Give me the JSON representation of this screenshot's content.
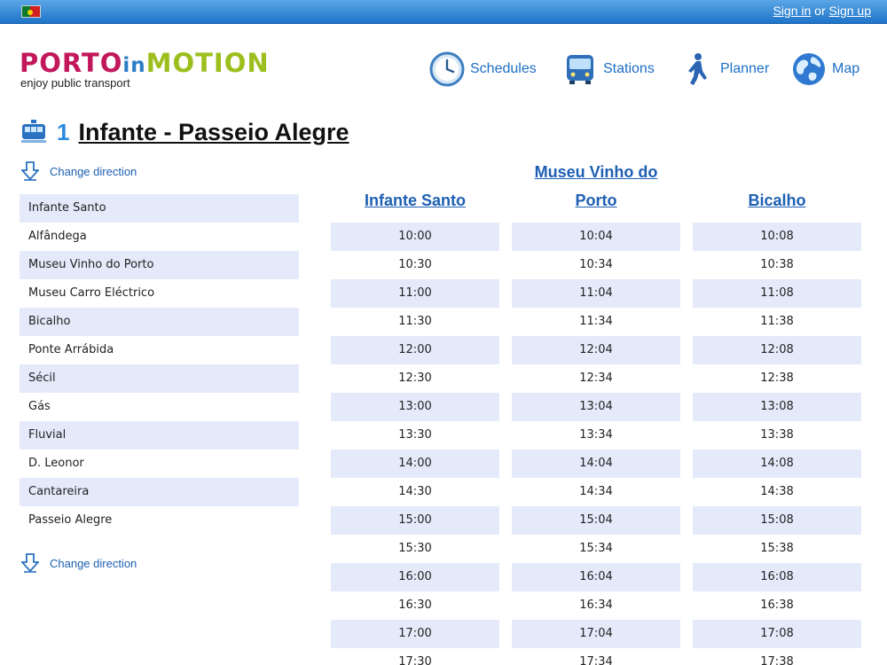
{
  "topbar": {
    "signin": "Sign in",
    "or": "or",
    "signup": "Sign up"
  },
  "logo": {
    "part1": "PORTO",
    "part2": "in",
    "part3": "MOTION",
    "tagline": "enjoy public transport"
  },
  "nav": [
    {
      "label": "Schedules",
      "icon": "clock-icon"
    },
    {
      "label": "Stations",
      "icon": "bus-icon"
    },
    {
      "label": "Planner",
      "icon": "walking-person-icon"
    },
    {
      "label": "Map",
      "icon": "globe-icon"
    }
  ],
  "route": {
    "number": "1",
    "name": "Infante - Passeio Alegre",
    "icon": "tram-icon"
  },
  "change_direction": "Change direction",
  "stops": [
    "Infante Santo",
    "Alfândega",
    "Museu Vinho do Porto",
    "Museu Carro Eléctrico",
    "Bicalho",
    "Ponte Arrábida",
    "Sécil",
    "Gás",
    "Fluvial",
    "D. Leonor",
    "Cantareira",
    "Passeio Alegre"
  ],
  "timetable": {
    "columns": [
      {
        "header_line1": "",
        "header_line2": "Infante Santo",
        "times": [
          "10:00",
          "10:30",
          "11:00",
          "11:30",
          "12:00",
          "12:30",
          "13:00",
          "13:30",
          "14:00",
          "14:30",
          "15:00",
          "15:30",
          "16:00",
          "16:30",
          "17:00",
          "17:30"
        ]
      },
      {
        "header_line1": "Museu Vinho do",
        "header_line2": "Porto",
        "times": [
          "10:04",
          "10:34",
          "11:04",
          "11:34",
          "12:04",
          "12:34",
          "13:04",
          "13:34",
          "14:04",
          "14:34",
          "15:04",
          "15:34",
          "16:04",
          "16:34",
          "17:04",
          "17:34"
        ]
      },
      {
        "header_line1": "",
        "header_line2": "Bicalho",
        "times": [
          "10:08",
          "10:38",
          "11:08",
          "11:38",
          "12:08",
          "12:38",
          "13:08",
          "13:38",
          "14:08",
          "14:38",
          "15:08",
          "15:38",
          "16:08",
          "16:38",
          "17:08",
          "17:38"
        ]
      }
    ]
  },
  "colors": {
    "accent": "#1d6fc4",
    "row_alt": "#e5eafb",
    "topbar": "#2a7fd0"
  }
}
